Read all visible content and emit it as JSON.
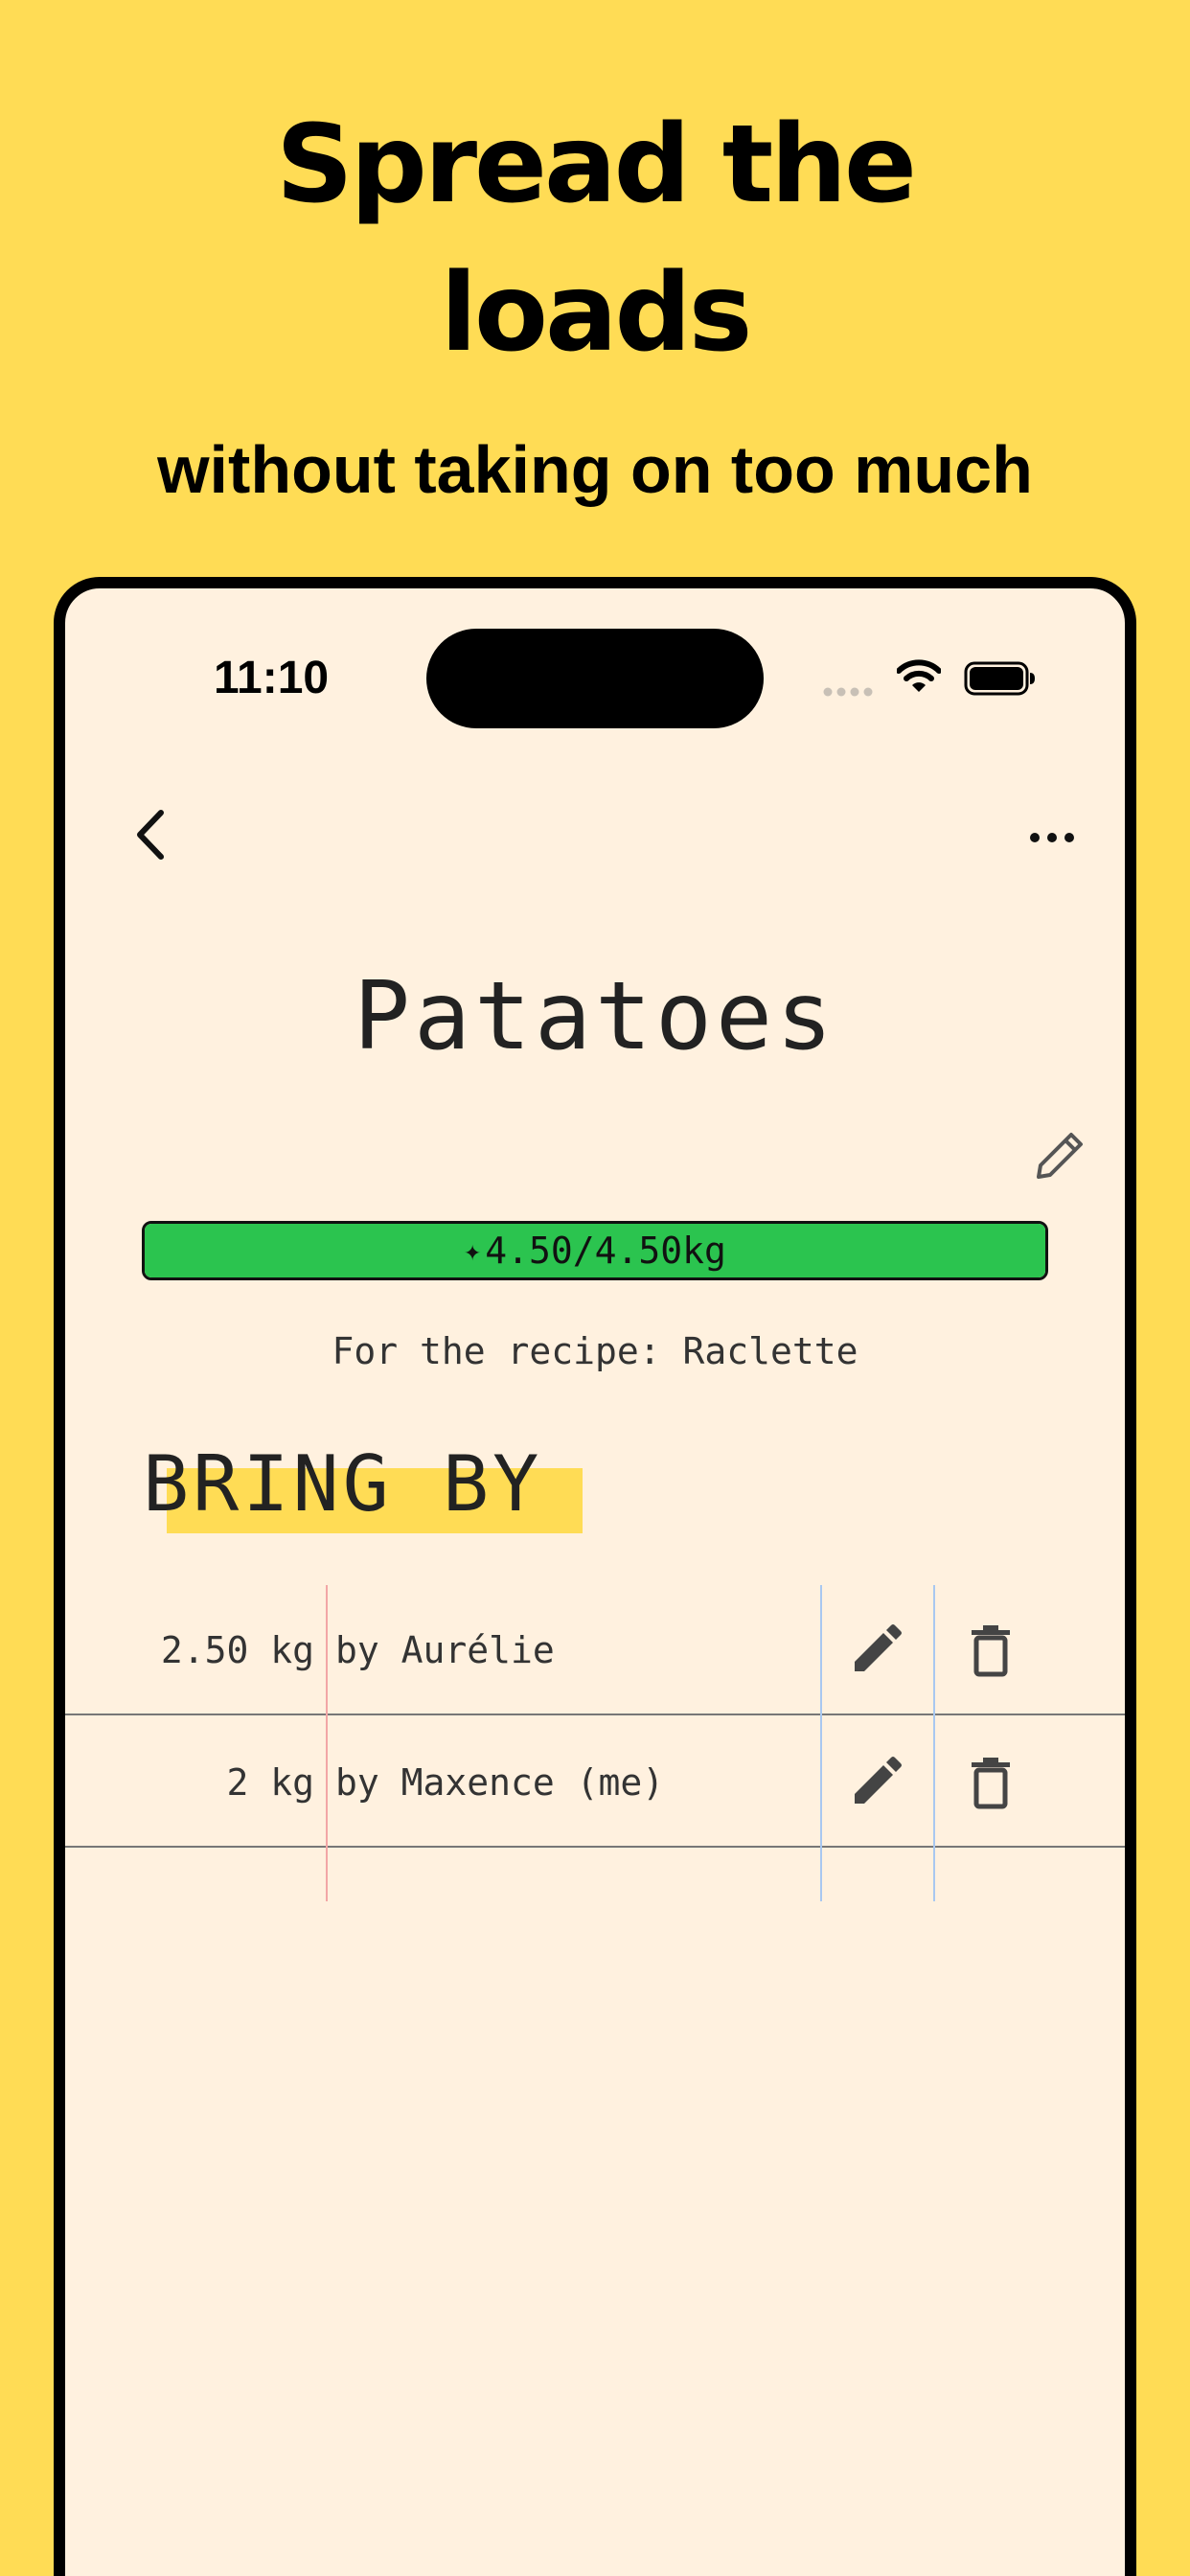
{
  "promo": {
    "headline_line1": "Spread the",
    "headline_line2": "loads",
    "subheadline": "without taking on too much"
  },
  "status_bar": {
    "time": "11:10",
    "icons": [
      "signal-icon",
      "wifi-icon",
      "battery-icon"
    ]
  },
  "nav": {
    "back_icon": "chevron-left-icon",
    "more_icon": "more-horizontal-icon"
  },
  "item": {
    "title": "Patatoes",
    "edit_icon": "pencil-icon",
    "progress": {
      "label": "4.50/4.50kg",
      "fraction": 1.0,
      "fill_color": "#2BC44F"
    },
    "recipe_line": "For the recipe: Raclette"
  },
  "section": {
    "title": "BRING BY",
    "highlight_color": "#FFDC55"
  },
  "contributions": [
    {
      "quantity": "2.50 kg",
      "person": "by Aurélie"
    },
    {
      "quantity": "2 kg",
      "person": "by Maxence (me)"
    }
  ],
  "colors": {
    "background": "#FFDC55",
    "screen": "#FFF1DF",
    "accent_green": "#2BC44F"
  }
}
